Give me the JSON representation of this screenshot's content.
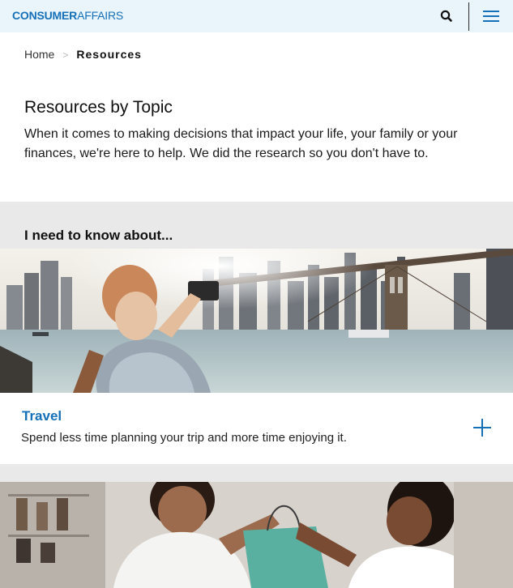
{
  "header": {
    "logo_bold": "CONSUMER",
    "logo_light": "AFFAIRS",
    "search_icon": "search-icon",
    "menu_icon": "hamburger-menu-icon",
    "accent_color": "#1670b8",
    "background_color": "#e9f4fb"
  },
  "breadcrumb": {
    "home": "Home",
    "separator": ">",
    "current": "Resources"
  },
  "page": {
    "title": "Resources by Topic",
    "intro": "When it comes to making decisions that impact your life, your family or your finances, we're here to help. We did the research so you don't have to."
  },
  "topics": {
    "heading": "I need to know about...",
    "cards": [
      {
        "title": "Travel",
        "description": "Spend less time planning your trip and more time enjoying it.",
        "expand_icon": "plus-icon"
      }
    ]
  }
}
